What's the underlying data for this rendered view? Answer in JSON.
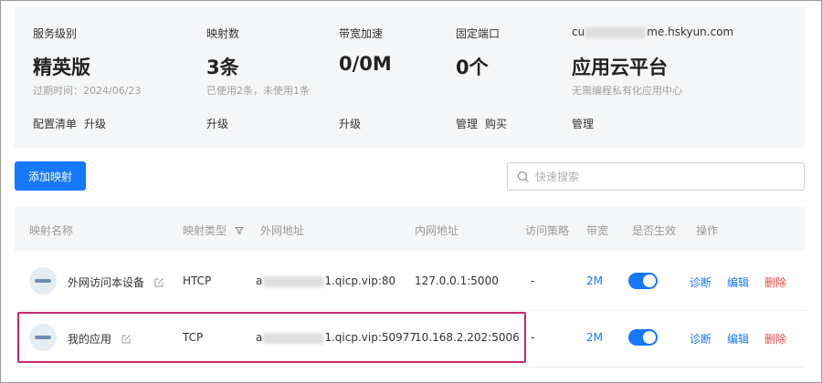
{
  "summary": {
    "service": {
      "label": "服务级别",
      "value": "精英版",
      "sub": "过期时间：2024/06/23",
      "actions": [
        "配置清单",
        "升级"
      ]
    },
    "mapping": {
      "label": "映射数",
      "value": "3条",
      "sub": "已使用2条，未使用1条",
      "actions": [
        "升级"
      ]
    },
    "bandwidth": {
      "label": "带宽加速",
      "value": "0/0M",
      "actions": [
        "升级"
      ]
    },
    "port": {
      "label": "固定端口",
      "value": "0个",
      "actions": [
        "管理",
        "购买"
      ]
    },
    "cloud": {
      "label_prefix": "cu",
      "label_suffix": "me.hskyun.com",
      "value": "应用云平台",
      "sub": "无需编程私有化应用中心",
      "actions": [
        "管理"
      ]
    }
  },
  "toolbar": {
    "add_label": "添加映射",
    "search_placeholder": "快速搜索"
  },
  "table": {
    "headers": {
      "name": "映射名称",
      "type": "映射类型",
      "external": "外网地址",
      "internal": "内网地址",
      "policy": "访问策略",
      "bandwidth": "带宽",
      "enabled": "是否生效",
      "ops": "操作"
    },
    "op_labels": {
      "diagnose": "诊断",
      "edit": "编辑",
      "delete": "删除"
    },
    "rows": [
      {
        "name": "外网访问本设备",
        "type": "HTCP",
        "ext_prefix": "a",
        "ext_suffix": "1.qicp.vip:80",
        "internal": "127.0.0.1:5000",
        "policy": "-",
        "bandwidth": "2M",
        "enabled": true
      },
      {
        "name": "我的应用",
        "type": "TCP",
        "ext_prefix": "a",
        "ext_suffix": "1.qicp.vip:50977",
        "internal": "10.168.2.202:5006",
        "policy": "-",
        "bandwidth": "2M",
        "enabled": true
      }
    ]
  },
  "colors": {
    "accent": "#1677ff",
    "danger": "#f04848",
    "highlight": "#c8286b"
  }
}
